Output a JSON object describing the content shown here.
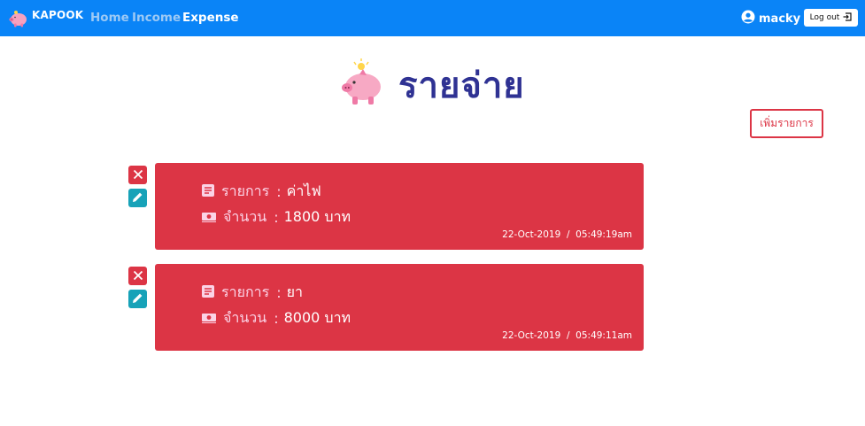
{
  "navbar": {
    "brand": "KAPOOK",
    "links": [
      "Home",
      "Income",
      "Expense"
    ],
    "active": "Expense",
    "user": "macky",
    "logout_label": "Log out"
  },
  "page": {
    "title": "รายจ่าย",
    "add_label": "เพิ่มรายการ"
  },
  "items": [
    {
      "item_label": "รายการ",
      "item_value": "ค่าไฟ",
      "amount_label": "จำนวน",
      "amount_value": "1800 บาท",
      "date": "22-Oct-2019",
      "time": "05:49:19am"
    },
    {
      "item_label": "รายการ",
      "item_value": "ยา",
      "amount_label": "จำนวน",
      "amount_value": "8000 บาท",
      "date": "22-Oct-2019",
      "time": "05:49:11am"
    }
  ],
  "colors": {
    "navbar": "#0a84f7",
    "card": "#dc3545",
    "edit": "#17a2b8",
    "title": "#2f3293"
  },
  "icons": [
    "piggy-bank-icon",
    "user-circle-icon",
    "logout-icon",
    "close-icon",
    "pencil-icon",
    "list-icon",
    "money-icon"
  ]
}
